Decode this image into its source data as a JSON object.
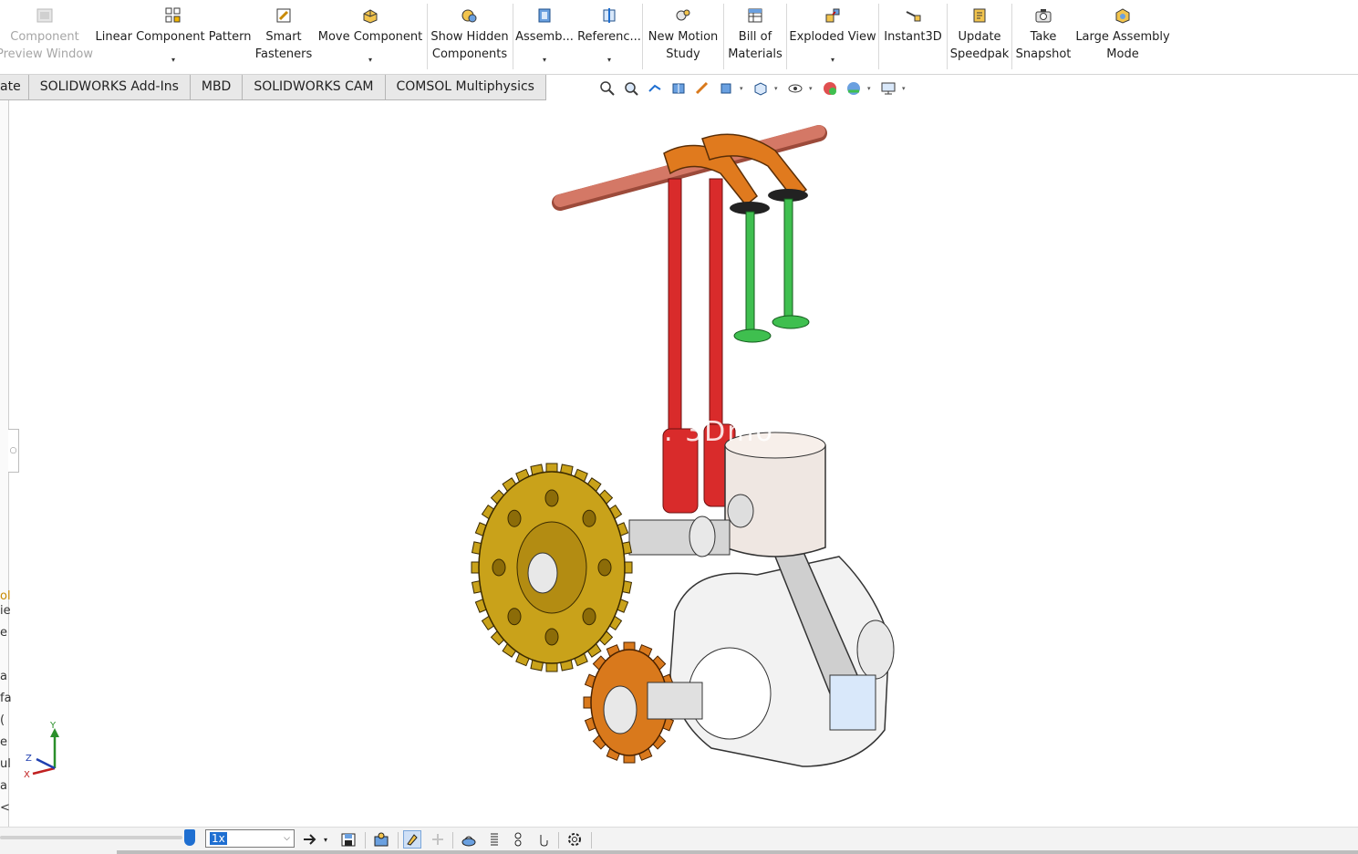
{
  "ribbon": {
    "items": [
      {
        "label1": "Component",
        "label2": "Preview Window",
        "dropdown": false,
        "enabled": false
      },
      {
        "label1": "Linear Component Pattern",
        "label2": "",
        "dropdown": true,
        "enabled": true
      },
      {
        "label1": "Smart",
        "label2": "Fasteners",
        "dropdown": false,
        "enabled": true
      },
      {
        "label1": "Move Component",
        "label2": "",
        "dropdown": true,
        "enabled": true
      },
      {
        "label1": "Show Hidden",
        "label2": "Components",
        "dropdown": false,
        "enabled": true
      },
      {
        "label1": "Assemb...",
        "label2": "",
        "dropdown": true,
        "enabled": true
      },
      {
        "label1": "Referenc...",
        "label2": "",
        "dropdown": true,
        "enabled": true
      },
      {
        "label1": "New Motion",
        "label2": "Study",
        "dropdown": false,
        "enabled": true
      },
      {
        "label1": "Bill of",
        "label2": "Materials",
        "dropdown": false,
        "enabled": true
      },
      {
        "label1": "Exploded View",
        "label2": "",
        "dropdown": true,
        "enabled": true
      },
      {
        "label1": "Instant3D",
        "label2": "",
        "dropdown": false,
        "enabled": true
      },
      {
        "label1": "Update",
        "label2": "Speedpak",
        "dropdown": false,
        "enabled": true
      },
      {
        "label1": "Take",
        "label2": "Snapshot",
        "dropdown": false,
        "enabled": true
      },
      {
        "label1": "Large Assembly",
        "label2": "Mode",
        "dropdown": false,
        "enabled": true
      }
    ]
  },
  "tabs": [
    "ate",
    "SOLIDWORKS Add-Ins",
    "MBD",
    "SOLIDWORKS CAM",
    "COMSOL Multiphysics"
  ],
  "left_pane_fragments": [
    "ol",
    "ie",
    "e",
    "a",
    "fa",
    "(",
    "e",
    "ul",
    "a",
    "<"
  ],
  "triad": {
    "y": "Y",
    "z": "Z",
    "x": "X"
  },
  "watermark": ". 3Dmo",
  "status": {
    "speed": "1x"
  },
  "colors": {
    "gear_large": "#c9a21a",
    "gear_small": "#d9791c",
    "rocker": "#e07a1e",
    "pushrod": "#d92b2b",
    "valve": "#3fbf4f",
    "shaft": "#d47866",
    "selected_blue": "#1f6fd1"
  }
}
